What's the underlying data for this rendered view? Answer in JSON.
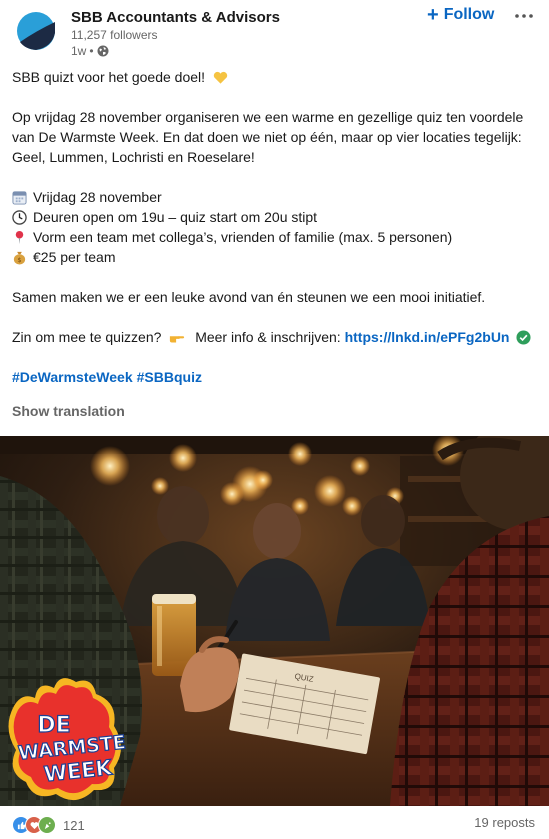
{
  "header": {
    "org_name": "SBB Accountants & Advisors",
    "followers": "11,257 followers",
    "time": "1w",
    "dot": "•",
    "follow_plus": "+",
    "follow_label": "Follow"
  },
  "post": {
    "title_line": "SBB quizt voor het goede doel!",
    "paragraph1": [
      "Op vrijdag 28 november organiseren we een warme en gezellige quiz ten voordele",
      "van De Warmste Week. En dat doen we niet op één, maar op vier locaties tegelijk:",
      "Geel, Lummen, Lochristi en Roeselare!"
    ],
    "details": [
      {
        "icon": "calendar-icon",
        "text": "Vrijdag 28 november"
      },
      {
        "icon": "clock-icon",
        "text": "Deuren open om 19u – quiz start om 20u stipt"
      },
      {
        "icon": "pin-icon",
        "text": "Vorm een team met collega’s, vrienden of familie (max. 5 personen)"
      },
      {
        "icon": "money-bag-icon",
        "text": "€25 per team"
      }
    ],
    "paragraph2": "Samen maken we er een leuke avond van én steunen we een mooi initiatief.",
    "cta_prefix": "Zin om mee te quizzen?",
    "cta_middle": "Meer info & inschrijven:",
    "link": "https://lnkd.in/ePFg2bUn",
    "hashtags": [
      "#DeWarmsteWeek",
      "#SBBquiz"
    ],
    "show_translation": "Show translation"
  },
  "image": {
    "badge_lines": [
      "DE",
      "WARMSTE",
      "WEEK"
    ],
    "sheet_heading": "QUIZ"
  },
  "footer": {
    "reaction_count": "121",
    "reposts": "19 reposts"
  },
  "colors": {
    "link": "#0a66c2",
    "muted": "#666666",
    "text": "#191919"
  }
}
